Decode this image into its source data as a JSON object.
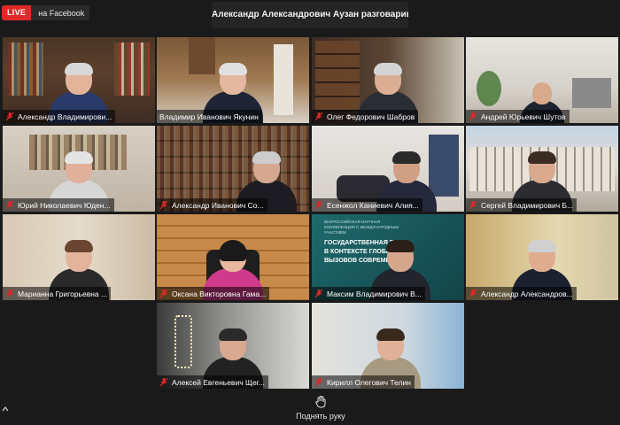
{
  "live": {
    "badge": "LIVE",
    "destination": "на Facebook"
  },
  "speaker_banner": "Александр Александрович Аузан разговаривает...",
  "participants": [
    {
      "name": "Александр Владимирови...",
      "muted": true
    },
    {
      "name": "Владимир Иванович Якунин",
      "muted": false
    },
    {
      "name": "Олег Федорович Шабров",
      "muted": true
    },
    {
      "name": "Андрей Юрьевич Шутов",
      "muted": true
    },
    {
      "name": "Юрий Николаевич Юден...",
      "muted": true
    },
    {
      "name": "Александр Иванович Со...",
      "muted": true
    },
    {
      "name": "Есенжол Каниевич Алия...",
      "muted": true
    },
    {
      "name": "Сергей Владимирович Б...",
      "muted": true
    },
    {
      "name": "Марианна Григорьевна ...",
      "muted": true
    },
    {
      "name": "Оксана Викторовна Гама...",
      "muted": true
    },
    {
      "name": "Максим Владимирович В...",
      "muted": true
    },
    {
      "name": "Александр Александров...",
      "muted": true,
      "active_speaker": true
    },
    {
      "name": "Алексей Евгеньевич Щег...",
      "muted": true
    },
    {
      "name": "Кирилл Олегович Телин",
      "muted": true
    }
  ],
  "slide_text": {
    "line1": "ВСЕРОССИЙСКАЯ НАУЧНАЯ",
    "line2": "КОНФЕРЕНЦИЯ С МЕЖДУНАРОДНЫМ",
    "line3": "УЧАСТИЕМ",
    "line4": "ГОСУДАРСТВЕННАЯ П",
    "line5": "В КОНТЕКСТЕ ГЛОБАЛ",
    "line6": "ВЫЗОВОВ СОВРЕМЕН"
  },
  "controls": {
    "raise_hand_label": "Поднять руку"
  },
  "colors": {
    "live_red": "#e02828",
    "active_outline": "#b8e03a",
    "mute_red": "#e02828"
  }
}
